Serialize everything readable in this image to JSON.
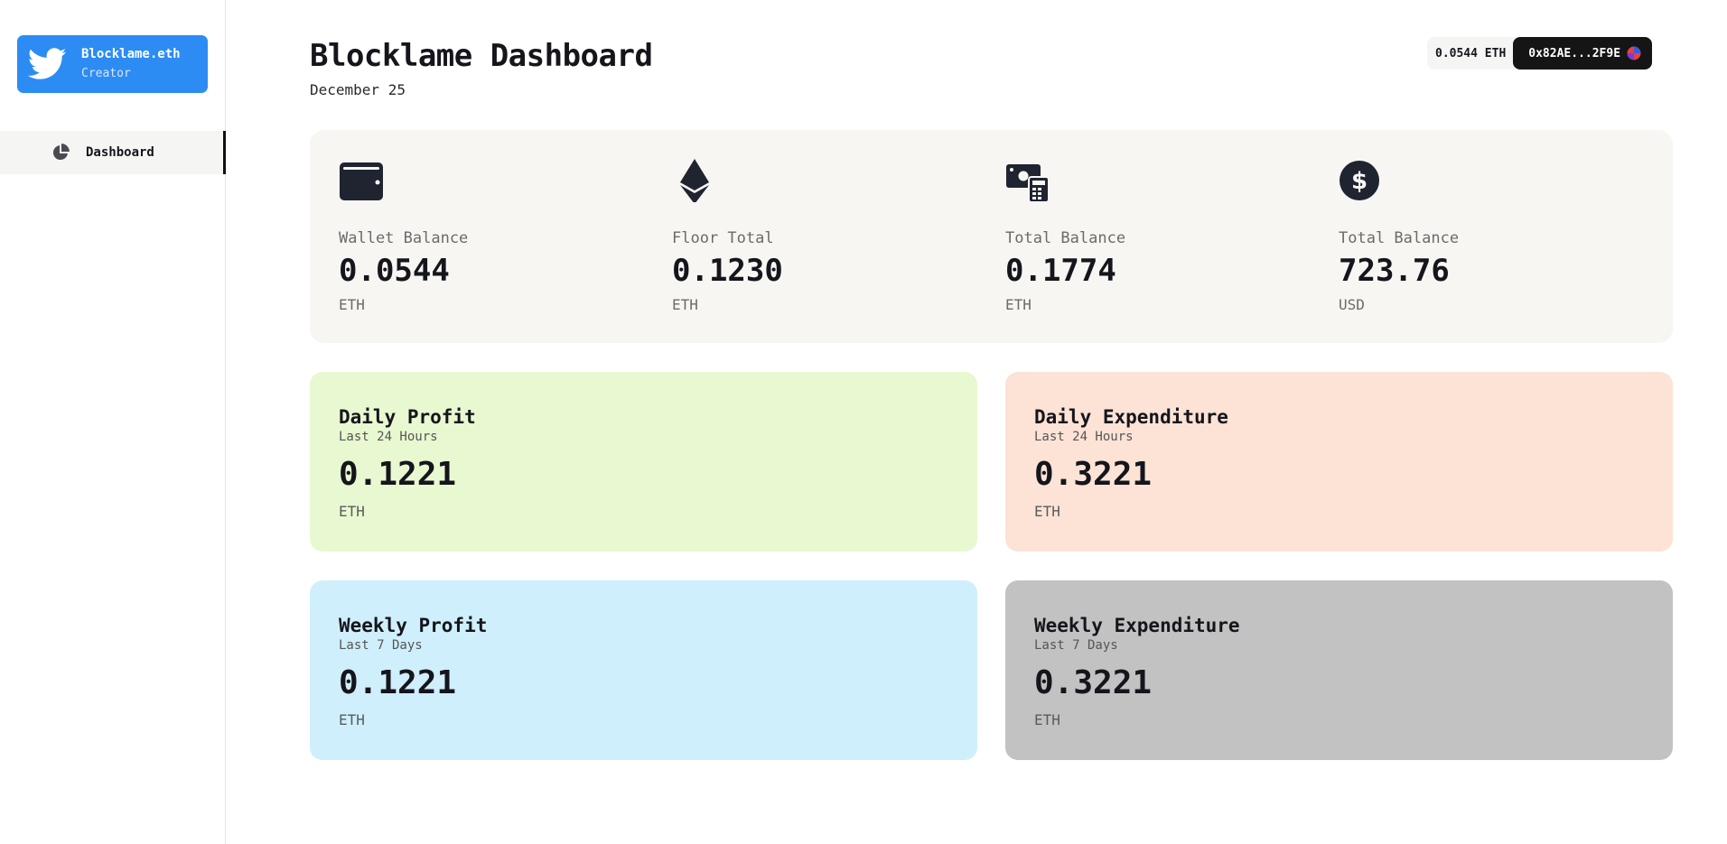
{
  "sidebar": {
    "profile": {
      "name": "Blocklame.eth",
      "role": "Creator",
      "icon": "twitter-bird-icon"
    },
    "nav": [
      {
        "label": "Dashboard",
        "icon": "pie-chart-icon",
        "active": true
      }
    ]
  },
  "header": {
    "title": "Blocklame Dashboard",
    "date": "December 25",
    "eth_balance": "0.0544 ETH",
    "address": "0x82AE...2F9E"
  },
  "stats": [
    {
      "label": "Wallet Balance",
      "value": "0.0544",
      "unit": "ETH",
      "icon": "wallet-icon"
    },
    {
      "label": "Floor Total",
      "value": "0.1230",
      "unit": "ETH",
      "icon": "ethereum-icon"
    },
    {
      "label": "Total Balance",
      "value": "0.1774",
      "unit": "ETH",
      "icon": "money-calculator-icon"
    },
    {
      "label": "Total Balance",
      "value": "723.76",
      "unit": "USD",
      "icon": "dollar-coin-icon"
    }
  ],
  "cards": {
    "daily_profit": {
      "title": "Daily Profit",
      "subtitle": "Last 24 Hours",
      "value": "0.1221",
      "unit": "ETH",
      "color": "#e8f8d0"
    },
    "daily_expenditure": {
      "title": "Daily Expenditure",
      "subtitle": "Last 24 Hours",
      "value": "0.3221",
      "unit": "ETH",
      "color": "#fce3d6"
    },
    "weekly_profit": {
      "title": "Weekly Profit",
      "subtitle": "Last 7 Days",
      "value": "0.1221",
      "unit": "ETH",
      "color": "#cfeffc"
    },
    "weekly_expenditure": {
      "title": "Weekly Expenditure",
      "subtitle": "Last 7 Days",
      "value": "0.3221",
      "unit": "ETH",
      "color": "#c2c2c2"
    }
  },
  "colors": {
    "accent": "#2c8cf4",
    "dark": "#151515",
    "panel": "#f7f6f3"
  }
}
